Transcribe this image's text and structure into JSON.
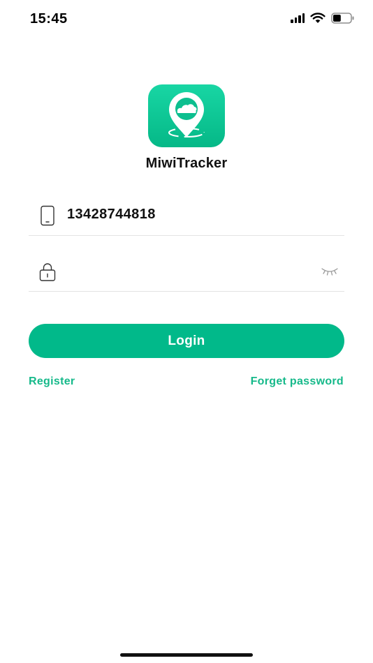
{
  "status_bar": {
    "time": "15:45",
    "battery_level": 0.45,
    "icons": [
      "signal-icon",
      "wifi-icon",
      "battery-icon"
    ]
  },
  "app": {
    "name": "MiwiTracker",
    "logo_icon": "location-pin-cloud-icon",
    "brand_color": "#01b98a"
  },
  "form": {
    "phone": {
      "icon": "phone-icon",
      "value": "13428744818"
    },
    "password": {
      "icon": "lock-icon",
      "value": "",
      "toggle_icon": "eye-closed-icon"
    },
    "login_label": "Login",
    "register_label": "Register",
    "forget_label": "Forget password"
  }
}
